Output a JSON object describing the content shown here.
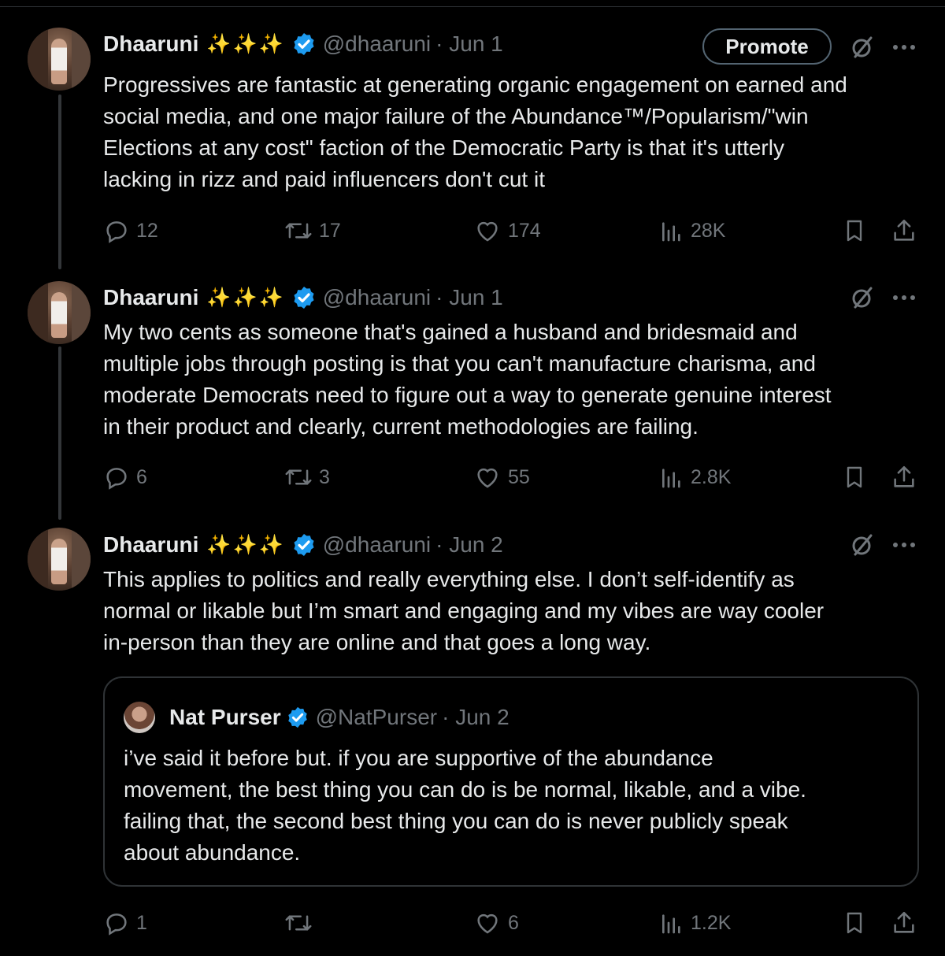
{
  "tweets": [
    {
      "name": "Dhaaruni",
      "sparkles": "✨✨✨",
      "handle": "@dhaaruni",
      "date": "· Jun 1",
      "promote_label": "Promote",
      "text": "Progressives are fantastic at generating organic engagement on earned and\nsocial media, and one major failure of the Abundance™/Popularism/\"win\nElections at any cost\" faction of the Democratic Party is that it's utterly\nlacking in rizz and paid influencers don't cut it",
      "replies": "12",
      "reposts": "17",
      "likes": "174",
      "views": "28K"
    },
    {
      "name": "Dhaaruni",
      "sparkles": "✨✨✨",
      "handle": "@dhaaruni",
      "date": "· Jun 1",
      "text": "My two cents as someone that's gained a husband and bridesmaid and\nmultiple jobs through posting is that you can't manufacture charisma, and\nmoderate Democrats need to figure out a way to generate genuine interest\nin their product and clearly, current methodologies are failing.",
      "replies": "6",
      "reposts": "3",
      "likes": "55",
      "views": "2.8K"
    },
    {
      "name": "Dhaaruni",
      "sparkles": "✨✨✨",
      "handle": "@dhaaruni",
      "date": "· Jun 2",
      "text": "This applies to politics and really everything else. I don’t self-identify as\nnormal or likable but I’m smart and engaging and my vibes are way cooler\nin-person than they are online and that goes a long way.",
      "replies": "1",
      "reposts": "",
      "likes": "6",
      "views": "1.2K",
      "quote": {
        "name": "Nat Purser",
        "handle": "@NatPurser",
        "date": "· Jun 2",
        "text": "i’ve said it before but. if you are supportive of the abundance\nmovement, the best thing you can do is be normal, likable, and a vibe.\nfailing that, the second best thing you can do is never publicly speak\nabout abundance."
      }
    }
  ],
  "colors": {
    "background": "#000000",
    "text": "#e7e9ea",
    "muted": "#71767b",
    "verified": "#1d9bf0",
    "sparkle": "#f5c518"
  },
  "icons": [
    "verified-badge-icon",
    "grok-icon",
    "more-icon",
    "reply-icon",
    "repost-icon",
    "like-icon",
    "views-icon",
    "bookmark-icon",
    "share-icon"
  ]
}
